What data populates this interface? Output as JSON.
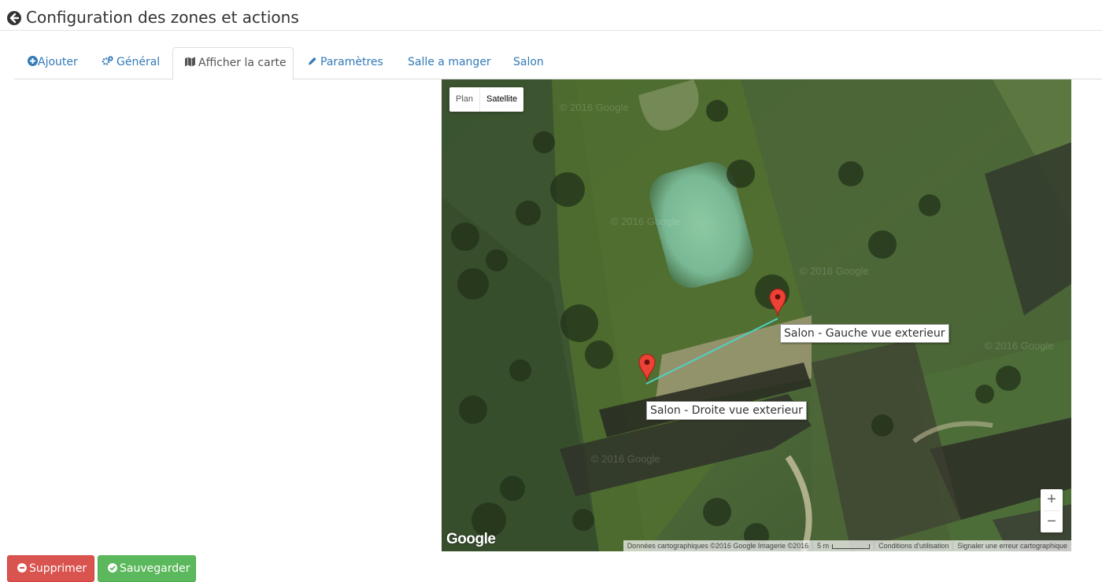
{
  "header": {
    "title": "Configuration des zones et actions"
  },
  "tabs": [
    {
      "label": "Ajouter",
      "icon": "plus-circle-icon"
    },
    {
      "label": "Général",
      "icon": "gears-icon"
    },
    {
      "label": "Afficher la carte",
      "icon": "map-icon"
    },
    {
      "label": "Paramètres",
      "icon": "pencil-icon"
    },
    {
      "label": "Salle a manger",
      "icon": ""
    },
    {
      "label": "Salon",
      "icon": ""
    }
  ],
  "active_tab": "Afficher la carte",
  "map": {
    "type_control": {
      "plan": "Plan",
      "satellite": "Satellite"
    },
    "selected_type": "Satellite",
    "markers": [
      {
        "label": "Salon - Gauche vue exterieur"
      },
      {
        "label": "Salon - Droite vue exterieur"
      }
    ],
    "zoom_in": "+",
    "zoom_out": "−",
    "logo": "Google",
    "watermark": "© 2016 Google",
    "attribution": {
      "data": "Données cartographiques ©2016 Google Imagerie ©2016",
      "scale": "5 m",
      "terms": "Conditions d'utilisation",
      "report": "Signaler une erreur cartographique"
    }
  },
  "buttons": {
    "delete": "Supprimer",
    "save": "Sauvegarder"
  },
  "colors": {
    "danger": "#d9534f",
    "success": "#5cb85c",
    "link": "#337ab7",
    "marker": "#ea4335",
    "polyline": "#4fd1c5"
  }
}
